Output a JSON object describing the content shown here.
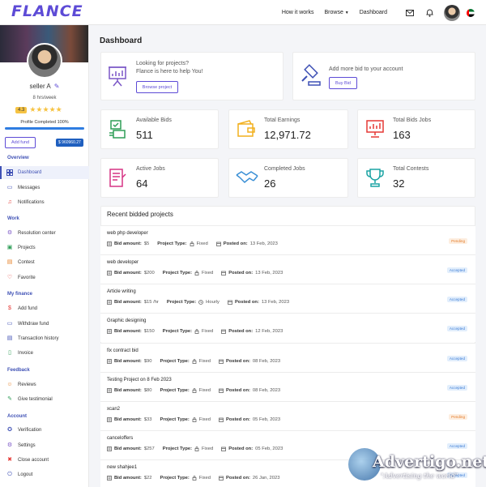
{
  "header": {
    "logo": "FLANCE",
    "nav": [
      "How it works",
      "Browse",
      "Dashboard"
    ]
  },
  "sidebar": {
    "name": "seller A",
    "hours": "8 hrs/week",
    "rating": "4.3",
    "profile": "Profile Completed 100%",
    "progress": 100,
    "add_fund": "Add fund",
    "balance": "$ 960960.27",
    "sections": [
      {
        "title": "Overview",
        "items": [
          "Dashboard",
          "Messages",
          "Notifications"
        ]
      },
      {
        "title": "Work",
        "items": [
          "Resolution center",
          "Projects",
          "Contest",
          "Favorite"
        ]
      },
      {
        "title": "My finance",
        "items": [
          "Add fund",
          "Withdraw fund",
          "Transaction history",
          "Invoice"
        ]
      },
      {
        "title": "Feedback",
        "items": [
          "Reviews",
          "Give testimonial"
        ]
      },
      {
        "title": "Account",
        "items": [
          "Verification",
          "Settings",
          "Close account",
          "Logout"
        ]
      }
    ]
  },
  "main": {
    "title": "Dashboard",
    "banners": [
      {
        "text1": "Looking for projects?",
        "text2": "Flance is here to help You!",
        "button": "Browse project"
      },
      {
        "text1": "Add more bid to your account",
        "text2": "",
        "button": "Buy Bid"
      }
    ],
    "stats": [
      {
        "label": "Available Bids",
        "value": "511"
      },
      {
        "label": "Total Earnings",
        "value": "12,971.72"
      },
      {
        "label": "Total Bids Jobs",
        "value": "163"
      },
      {
        "label": "Active Jobs",
        "value": "64"
      },
      {
        "label": "Completed Jobs",
        "value": "26"
      },
      {
        "label": "Total Contests",
        "value": "32"
      }
    ],
    "recent_title": "Recent bidded projects",
    "labels": {
      "bid": "Bid amount:",
      "type": "Project Type:",
      "posted": "Posted on:"
    },
    "projects": [
      {
        "title": "web php developer",
        "bid": "$5",
        "type": "Fixed",
        "posted": "13 Feb, 2023",
        "status": "Pending"
      },
      {
        "title": "web developer",
        "bid": "$200",
        "type": "Fixed",
        "posted": "13 Feb, 2023",
        "status": "Accepted"
      },
      {
        "title": "Article writing",
        "bid": "$15 /hr",
        "type": "Hourly",
        "posted": "13 Feb, 2023",
        "status": "Accepted"
      },
      {
        "title": "Graphic designing",
        "bid": "$150",
        "type": "Fixed",
        "posted": "12 Feb, 2023",
        "status": "Accepted"
      },
      {
        "title": "fix contract bid",
        "bid": "$90",
        "type": "Fixed",
        "posted": "08 Feb, 2023",
        "status": "Accepted"
      },
      {
        "title": "Testing Project on 8 Feb 2023",
        "bid": "$80",
        "type": "Fixed",
        "posted": "08 Feb, 2023",
        "status": "Accepted"
      },
      {
        "title": "xcan2",
        "bid": "$33",
        "type": "Fixed",
        "posted": "05 Feb, 2023",
        "status": "Pending"
      },
      {
        "title": "canceloffers",
        "bid": "$257",
        "type": "Fixed",
        "posted": "05 Feb, 2023",
        "status": "Accepted"
      },
      {
        "title": "new shahjee1",
        "bid": "$22",
        "type": "Fixed",
        "posted": "26 Jan, 2023",
        "status": "Accepted"
      }
    ]
  },
  "watermark": {
    "line1": "Advertigo.net",
    "line2": "\"Advertising the world\""
  }
}
